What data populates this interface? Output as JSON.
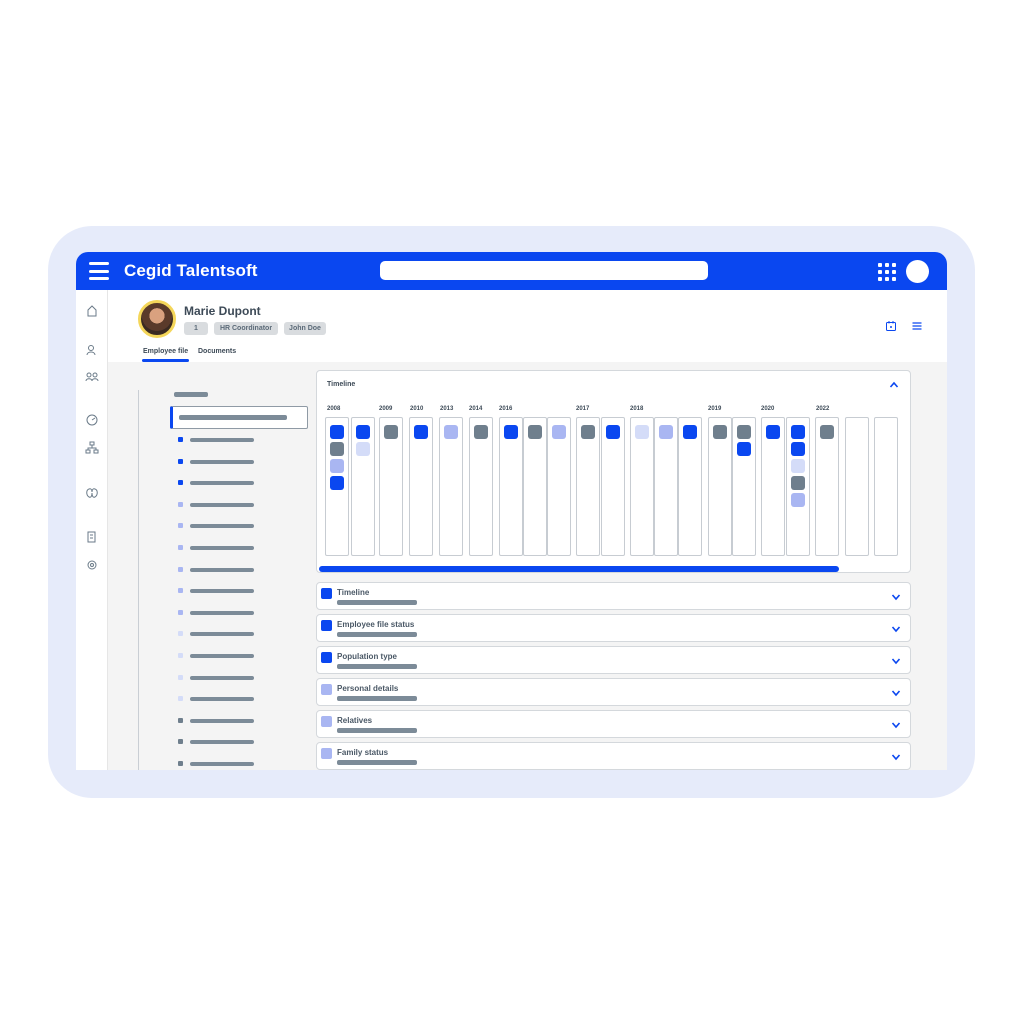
{
  "app": {
    "title": "Cegid Talentsoft"
  },
  "search": {
    "placeholder": ""
  },
  "colors": {
    "brand": "#0a47f0",
    "gray": "#6f7f8d",
    "light": "#a9b6f2",
    "pale": "#d4dcf8"
  },
  "employee": {
    "name": "Marie Dupont",
    "tags": [
      "1",
      "HR Coordinator",
      "John Doe"
    ]
  },
  "tabs": [
    {
      "label": "Employee file",
      "active": true
    },
    {
      "label": "Documents",
      "active": false
    }
  ],
  "timeline": {
    "title": "Timeline",
    "years": [
      "2008",
      "2009",
      "2010",
      "2013",
      "2014",
      "2016",
      "2017",
      "2018",
      "2019",
      "2020",
      "2022"
    ]
  },
  "sections": [
    {
      "label": "Timeline",
      "color": "#0a47f0"
    },
    {
      "label": "Employee file status",
      "color": "#0a47f0"
    },
    {
      "label": "Population type",
      "color": "#0a47f0"
    },
    {
      "label": "Personal details",
      "color": "#a9b6f2"
    },
    {
      "label": "Relatives",
      "color": "#a9b6f2"
    },
    {
      "label": "Family status",
      "color": "#a9b6f2"
    }
  ]
}
